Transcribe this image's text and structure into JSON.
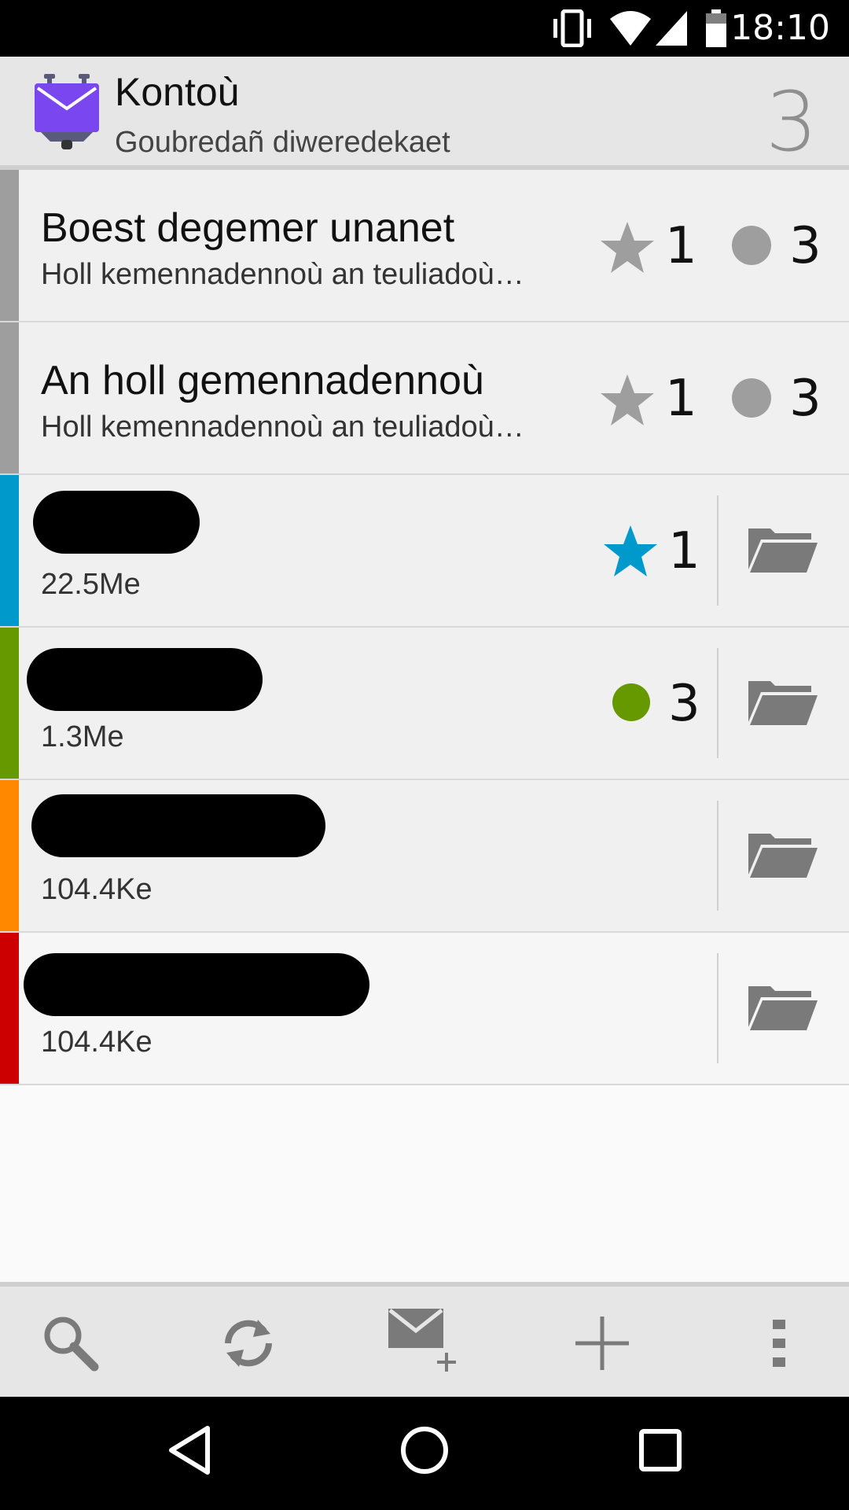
{
  "status_bar": {
    "time": "18:10",
    "icons": [
      "vibrate-icon",
      "wifi-icon",
      "signal-icon",
      "battery-icon"
    ]
  },
  "app_bar": {
    "title": "Kontoù",
    "subtitle": "Goubredañ diweredekaet",
    "count": "3"
  },
  "colors": {
    "logo": "#7a46f0",
    "gray": "#9e9e9e",
    "blue": "#0099cc",
    "green": "#669900",
    "orange": "#ff8800",
    "red": "#cc0000"
  },
  "unified": [
    {
      "name": "Boest degemer unanet",
      "desc": "Holl kemennadennoù an teuliadoù…",
      "starred": "1",
      "unread": "3"
    },
    {
      "name": "An holl gemennadennoù",
      "desc": "Holl kemennadennoù an teuliadoù…",
      "starred": "1",
      "unread": "3"
    }
  ],
  "accounts": [
    {
      "size": "22.5Me",
      "starred": "1",
      "color": "#0099cc"
    },
    {
      "size": "1.3Me",
      "unread": "3",
      "color": "#669900"
    },
    {
      "size": "104.4Ke",
      "color": "#ff8800"
    },
    {
      "size": "104.4Ke",
      "color": "#cc0000"
    }
  ],
  "bottom_bar": [
    "search-icon",
    "refresh-icon",
    "compose-icon",
    "add-icon",
    "overflow-menu-icon"
  ],
  "nav_bar": [
    "back-icon",
    "home-icon",
    "recents-icon"
  ]
}
